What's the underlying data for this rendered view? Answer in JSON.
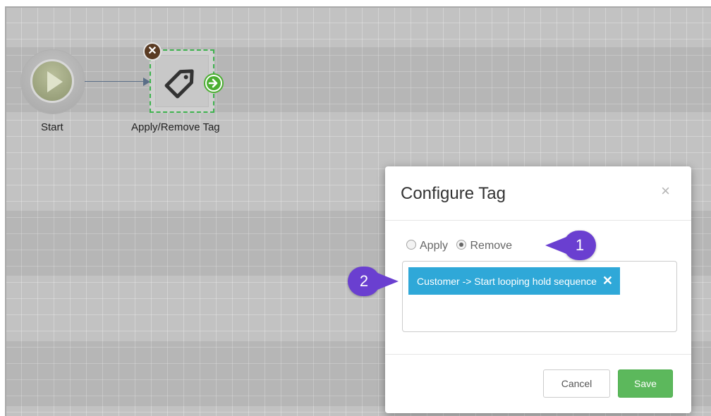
{
  "workflow": {
    "nodes": [
      {
        "label": "Start",
        "icon": "play-icon"
      },
      {
        "label": "Apply/Remove Tag",
        "icon": "tag-icon"
      }
    ]
  },
  "modal": {
    "title": "Configure Tag",
    "close_glyph": "×",
    "radio_options": [
      {
        "label": "Apply",
        "checked": false
      },
      {
        "label": "Remove",
        "checked": true
      }
    ],
    "tags": [
      {
        "label": "Customer -> Start looping hold sequence",
        "remove_glyph": "✕"
      }
    ],
    "cancel_label": "Cancel",
    "save_label": "Save"
  },
  "callouts": [
    "1",
    "2"
  ],
  "colors": {
    "accent_green": "#5cb85c",
    "tag_blue": "#2fa8d8",
    "callout_purple": "#6a3fd0",
    "node_remove_brown": "#5a3b23"
  }
}
